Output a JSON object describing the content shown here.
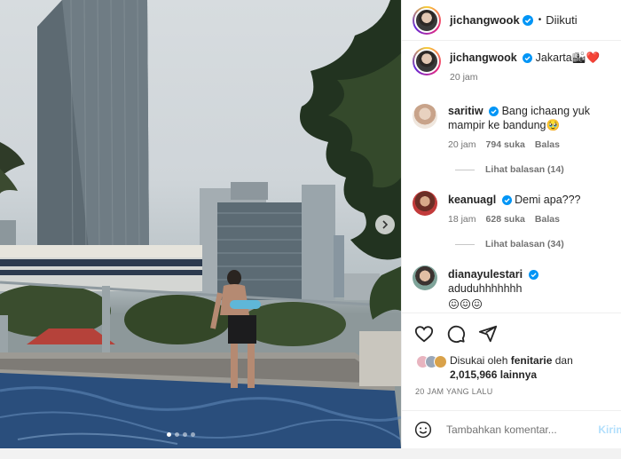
{
  "post": {
    "author": "jichangwook",
    "follow_separator": "•",
    "follow_status": "Diikuti",
    "caption": "Jakarta🏙❤️",
    "caption_time": "20 jam"
  },
  "comments": [
    {
      "username": "saritiw",
      "text": "Bang ichaang yuk mampir ke bandung🥹",
      "time": "20 jam",
      "likes": "794 suka",
      "reply_label": "Balas",
      "view_replies": "Lihat balasan (14)"
    },
    {
      "username": "keanuagl",
      "text": "Demi apa???",
      "time": "18 jam",
      "likes": "628 suka",
      "reply_label": "Balas",
      "view_replies": "Lihat balasan (34)"
    },
    {
      "username": "dianayulestari",
      "text": "aduduhhhhhhh",
      "emoji": "😖😖😖"
    }
  ],
  "likes": {
    "prefix": "Disukai oleh",
    "user": "fenitarie",
    "connector": "dan",
    "count": "2,015,966",
    "suffix": "lainnya"
  },
  "time_ago": "20 JAM YANG LALU",
  "add_comment": {
    "placeholder": "Tambahkan komentar...",
    "post_label": "Kirim"
  },
  "icons": {
    "like": "heart-icon",
    "comment": "comment-bubble-icon",
    "share": "paper-plane-icon",
    "emoji": "smiley-icon",
    "verified": "verified-badge-icon",
    "next": "chevron-right-icon"
  },
  "colors": {
    "verified": "#0095f6",
    "text": "#262626",
    "muted": "#737373"
  },
  "carousel": {
    "slides": 4,
    "active": 1
  }
}
